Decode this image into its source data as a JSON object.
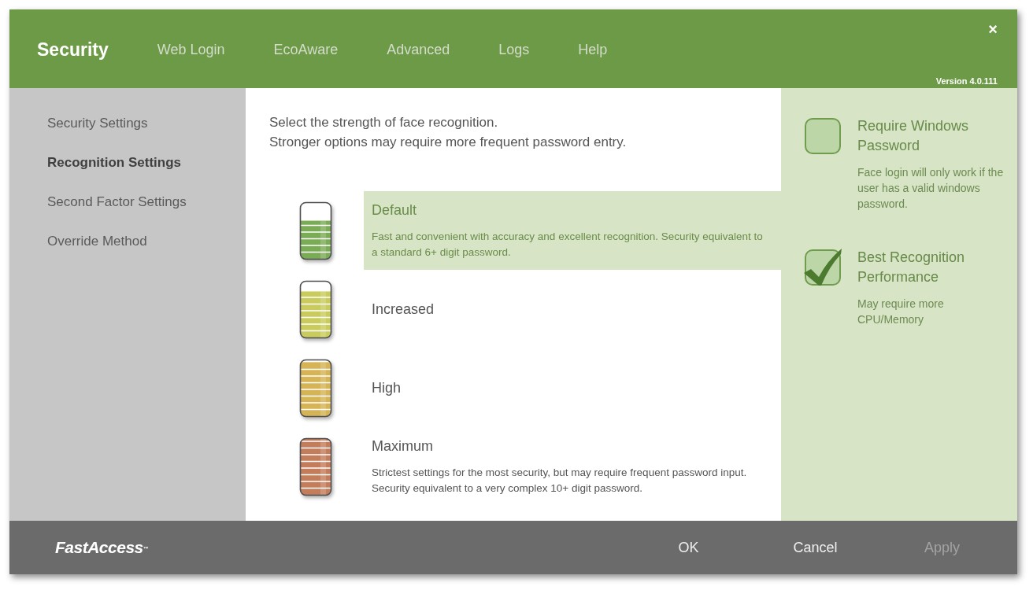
{
  "header": {
    "tabs": [
      {
        "label": "Security",
        "selected": true
      },
      {
        "label": "Web Login",
        "selected": false
      },
      {
        "label": "EcoAware",
        "selected": false
      },
      {
        "label": "Advanced",
        "selected": false
      },
      {
        "label": "Logs",
        "selected": false
      },
      {
        "label": "Help",
        "selected": false
      }
    ],
    "close": "×",
    "version": "Version 4.0.111"
  },
  "sidebar": {
    "items": [
      {
        "label": "Security Settings",
        "selected": false
      },
      {
        "label": "Recognition Settings",
        "selected": true
      },
      {
        "label": "Second Factor Settings",
        "selected": false
      },
      {
        "label": "Override Method",
        "selected": false
      }
    ]
  },
  "main": {
    "intro": [
      "Select the strength of face recognition.",
      "Stronger options may require more frequent password entry."
    ],
    "options": [
      {
        "label": "Default",
        "description": "Fast and convenient with accuracy and excellent recognition. Security equivalent to a standard 6+ digit password.",
        "selected": true,
        "level": 0.68,
        "color": "#7aab55"
      },
      {
        "label": "Increased",
        "selected": false,
        "level": 0.82,
        "color": "#c9cc5c"
      },
      {
        "label": "High",
        "selected": false,
        "level": 0.96,
        "color": "#d6b455"
      },
      {
        "label": "Maximum",
        "description": "Strictest settings for the most security, but may require frequent password input. Security equivalent to a very complex 10+ digit password.",
        "selected": false,
        "level": 1,
        "color": "#c47d5b"
      }
    ]
  },
  "side_options": [
    {
      "label": "Require Windows Password",
      "description": "Face login will only work if the user has a valid windows password.",
      "checked": false
    },
    {
      "label": "Best Recognition Performance",
      "description": "May require more CPU/Memory",
      "checked": true
    }
  ],
  "footer": {
    "logo": "FastAccess$^{™}$",
    "buttons": [
      {
        "label": "OK",
        "disabled": false
      },
      {
        "label": "Cancel",
        "disabled": false
      },
      {
        "label": "Apply",
        "disabled": true
      }
    ]
  }
}
